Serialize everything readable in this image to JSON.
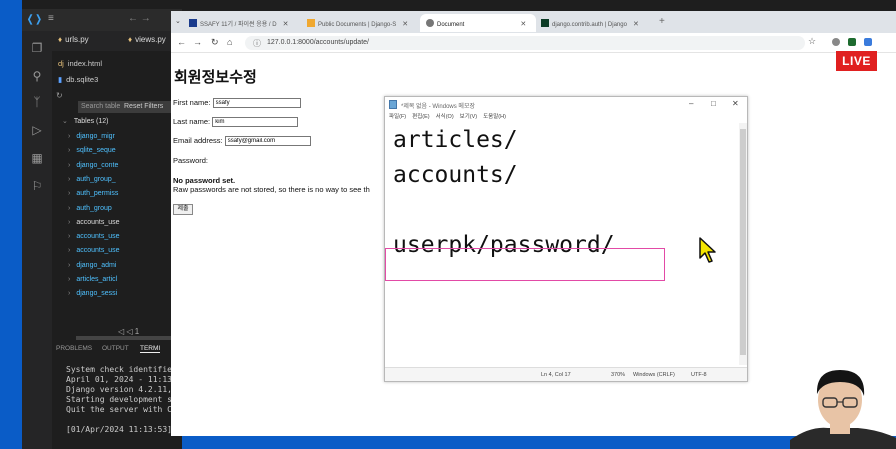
{
  "vscode": {
    "tabs": [
      "urls.py",
      "views.py"
    ],
    "files": [
      "index.html",
      "db.sqlite3"
    ],
    "search_placeholder": "Search table",
    "reset_filters": "Reset Filters",
    "tables_header": "Tables (12)",
    "tables": [
      {
        "name": "django_migr",
        "color": "blue"
      },
      {
        "name": "sqlite_seque",
        "color": "blue"
      },
      {
        "name": "django_conte",
        "color": "blue"
      },
      {
        "name": "auth_group_",
        "color": "blue"
      },
      {
        "name": "auth_permiss",
        "color": "blue"
      },
      {
        "name": "auth_group",
        "color": "blue"
      },
      {
        "name": "accounts_use",
        "color": "white"
      },
      {
        "name": "accounts_use",
        "color": "blue"
      },
      {
        "name": "accounts_use",
        "color": "blue"
      },
      {
        "name": "django_admi",
        "color": "blue"
      },
      {
        "name": "articles_articl",
        "color": "blue"
      },
      {
        "name": "django_sessi",
        "color": "blue"
      }
    ],
    "pager_value": "1",
    "panel_tabs": [
      "PROBLEMS",
      "OUTPUT",
      "TERMI"
    ],
    "terminal_lines": [
      "System check identified",
      "April 01, 2024 - 11:13:",
      "Django version 4.2.11,",
      "Starting development se",
      "Quit the server with CT",
      "",
      "[01/Apr/2024 11:13:53]"
    ]
  },
  "browser": {
    "tabs": [
      {
        "label": "SSAFY 11기 / 파이썬 응용 / D",
        "fav": "#1a3b8c"
      },
      {
        "label": "Public Documents | Django-S",
        "fav": "#f0a830"
      },
      {
        "label": "Document",
        "fav": "#777777",
        "active": true
      },
      {
        "label": "django.contrib.auth | Django",
        "fav": "#0c3c26"
      }
    ],
    "url": "127.0.0.1:8000/accounts/update/",
    "live_badge": "LIVE"
  },
  "page": {
    "title": "회원정보수정",
    "first_name_label": "First name:",
    "first_name_value": "ssafy",
    "last_name_label": "Last name:",
    "last_name_value": "kim",
    "email_label": "Email address:",
    "email_value": "ssafy@gmail.com",
    "password_label": "Password:",
    "no_password": "No password set.",
    "password_help": "Raw passwords are not stored, so there is no way to see th",
    "submit_label": "제출"
  },
  "notepad": {
    "title": "*제목 없음 - Windows 메모장",
    "menu": [
      "파일(F)",
      "편집(E)",
      "서식(O)",
      "보기(V)",
      "도움말(H)"
    ],
    "lines": [
      "articles/",
      "accounts/",
      "",
      "userpk/password/"
    ],
    "status": {
      "position": "Ln 4, Col 17",
      "zoom": "370%",
      "line_ending": "Windows (CRLF)",
      "encoding": "UTF-8"
    }
  }
}
